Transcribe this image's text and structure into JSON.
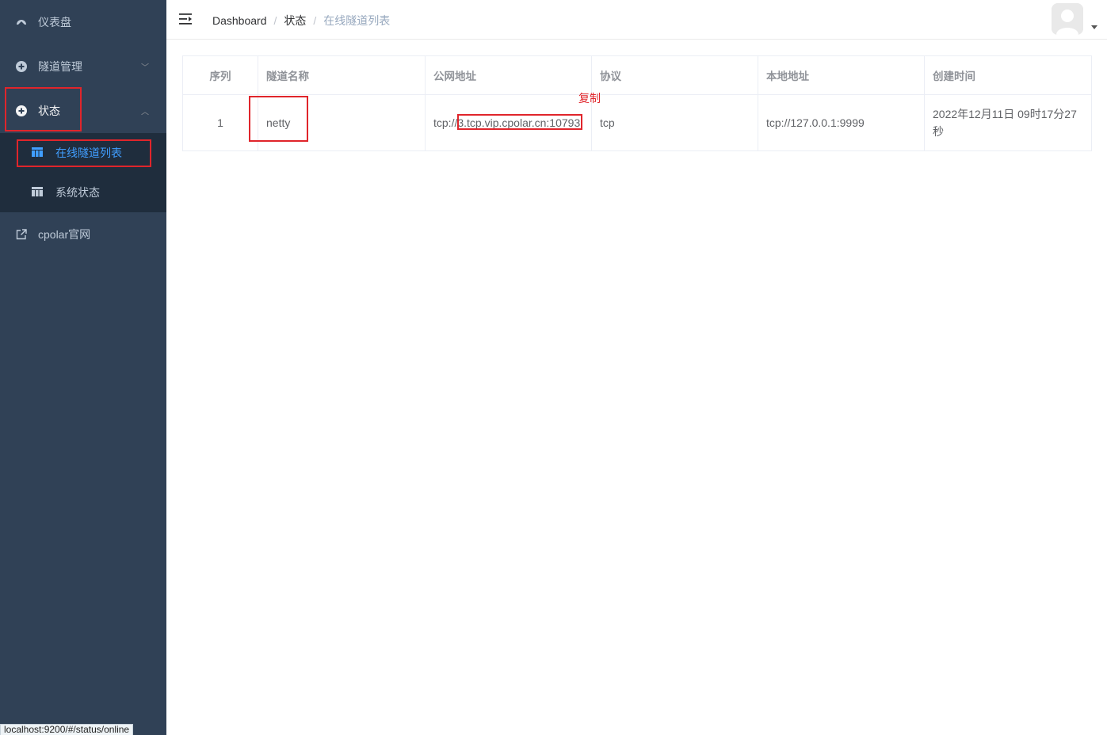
{
  "sidebar": {
    "items": [
      {
        "label": "仪表盘",
        "icon": "dashboard-icon"
      },
      {
        "label": "隧道管理",
        "icon": "plus-circle-icon",
        "arrow": "﹀"
      },
      {
        "label": "状态",
        "icon": "plus-circle-icon",
        "arrow": "︿"
      },
      {
        "label": "cpolar官网",
        "icon": "external-link-icon"
      }
    ],
    "subitems": [
      {
        "label": "在线隧道列表",
        "icon": "table-grid-icon",
        "active": true
      },
      {
        "label": "系统状态",
        "icon": "table-grid-icon",
        "active": false
      }
    ]
  },
  "header": {
    "breadcrumb": [
      "Dashboard",
      "状态",
      "在线隧道列表"
    ],
    "separator": "/"
  },
  "table": {
    "columns": [
      "序列",
      "隧道名称",
      "公网地址",
      "协议",
      "本地地址",
      "创建时间"
    ],
    "rows": [
      {
        "index": "1",
        "name": "netty",
        "public_prefix": "tcp://",
        "public_host": "3.tcp.vip.cpolar.cn:10793",
        "protocol": "tcp",
        "local": "tcp://127.0.0.1:9999",
        "created": "2022年12月11日 09时17分27秒"
      }
    ]
  },
  "annotation": {
    "copy_label": "复制",
    "color": "#e0252b"
  },
  "status_bar": {
    "url": "localhost:9200/#/status/online"
  },
  "colors": {
    "sidebar_bg": "#304156",
    "submenu_bg": "#1f2d3d",
    "active": "#409eff"
  }
}
